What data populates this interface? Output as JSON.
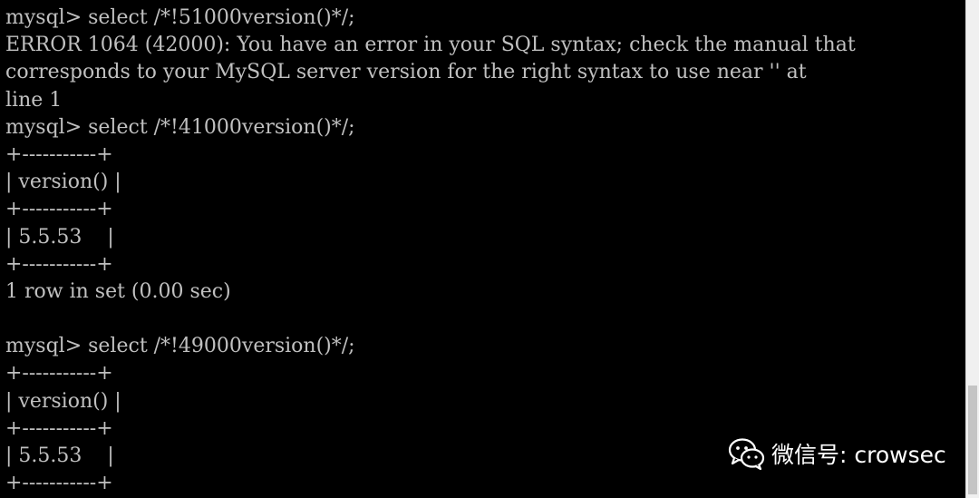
{
  "terminal": {
    "lines": [
      "mysql> select /*!51000version()*/;",
      "ERROR 1064 (42000): You have an error in your SQL syntax; check the manual that",
      "corresponds to your MySQL server version for the right syntax to use near '' at",
      "line 1",
      "mysql> select /*!41000version()*/;",
      "+-----------+",
      "| version() |",
      "+-----------+",
      "| 5.5.53    |",
      "+-----------+",
      "1 row in set (0.00 sec)",
      "",
      "mysql> select /*!49000version()*/;",
      "+-----------+",
      "| version() |",
      "+-----------+",
      "| 5.5.53    |",
      "+-----------+"
    ]
  },
  "watermark": {
    "icon": "wechat-icon",
    "text": "微信号: crowsec"
  },
  "colors": {
    "background": "#000000",
    "text": "#c0c0c0",
    "scrollbar": "#f0f0f0"
  }
}
